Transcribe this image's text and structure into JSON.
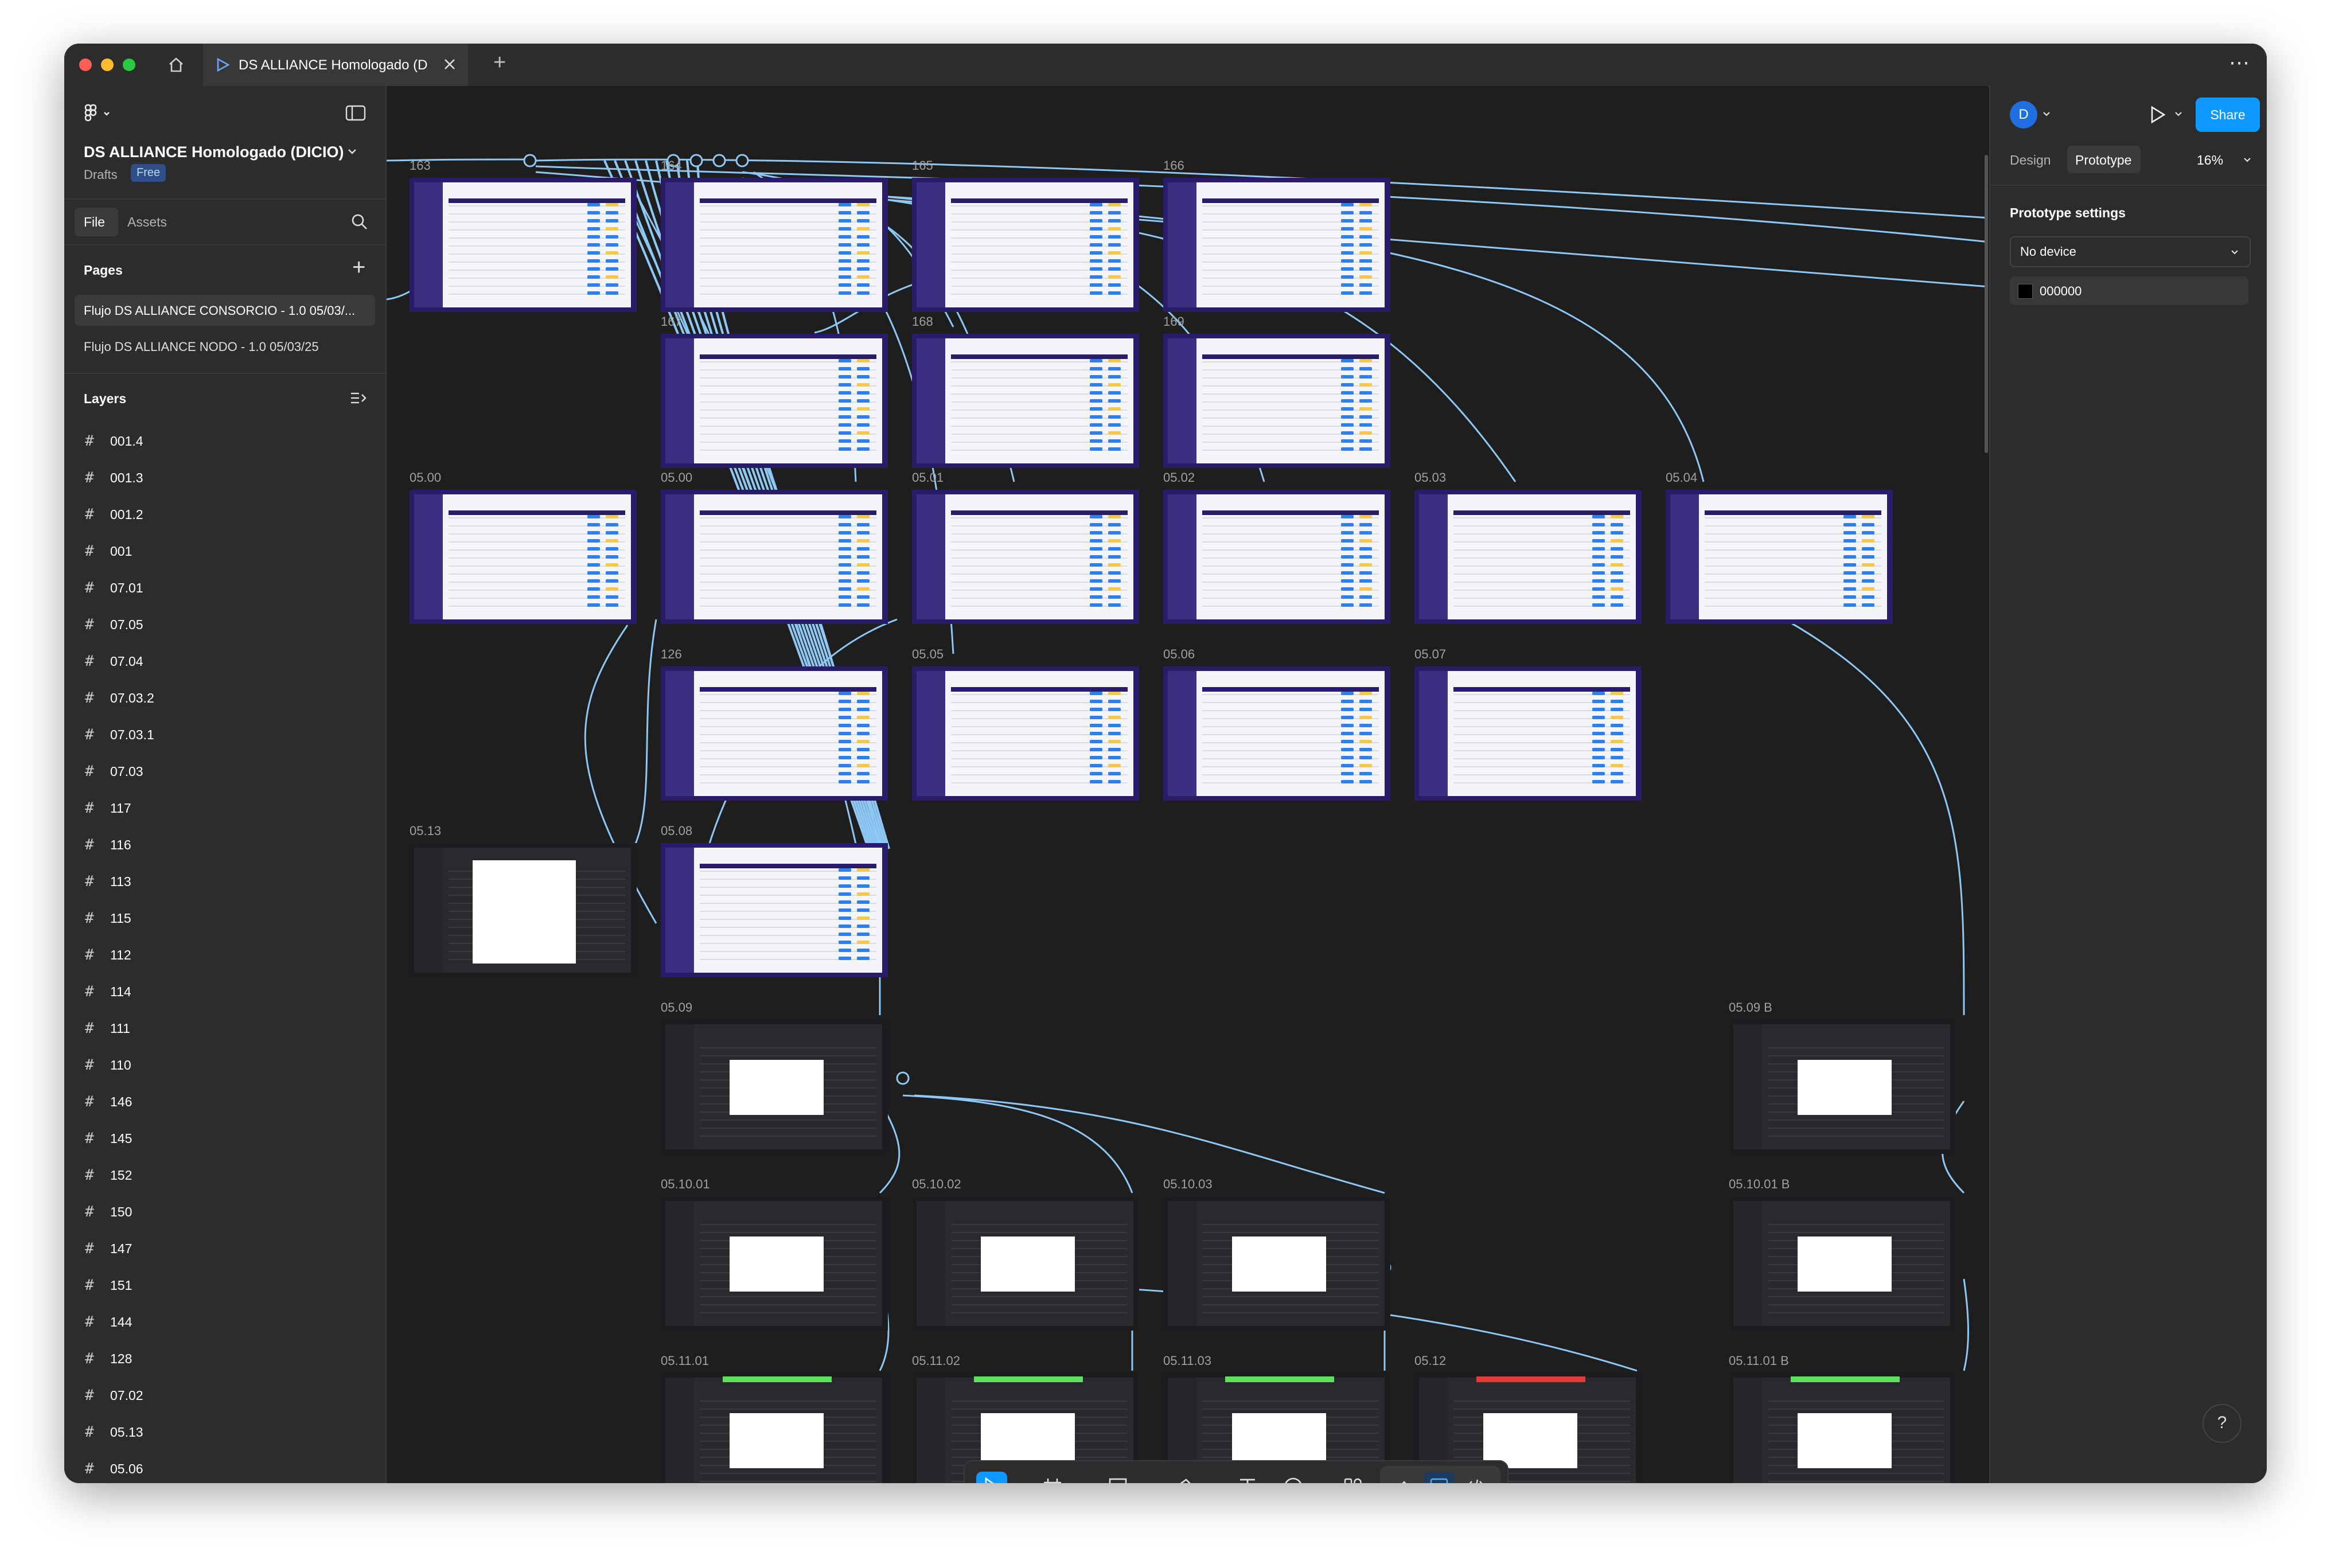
{
  "window": {
    "tab_title": "DS ALLIANCE Homologado (DICIO)",
    "new_tab": "+",
    "more": "⋯"
  },
  "left": {
    "file_name": "DS ALLIANCE Homologado (DICIO)",
    "drafts": "Drafts",
    "plan_badge": "Free",
    "tabs": {
      "file": "File",
      "assets": "Assets"
    },
    "pages_title": "Pages",
    "add_page": "+",
    "pages": [
      "Flujo DS ALLIANCE CONSORCIO - 1.0 05/03/...",
      "Flujo DS ALLIANCE NODO - 1.0 05/03/25"
    ],
    "layers_title": "Layers",
    "layers": [
      "001.4",
      "001.3",
      "001.2",
      "001",
      "07.01",
      "07.05",
      "07.04",
      "07.03.2",
      "07.03.1",
      "07.03",
      "117",
      "116",
      "113",
      "115",
      "112",
      "114",
      "111",
      "110",
      "146",
      "145",
      "152",
      "150",
      "147",
      "151",
      "144",
      "128",
      "07.02",
      "05.13",
      "05.06"
    ]
  },
  "right": {
    "avatar": "D",
    "share": "Share",
    "tab_design": "Design",
    "tab_prototype": "Prototype",
    "zoom": "16%",
    "settings_title": "Prototype settings",
    "device": "No device",
    "bg_color_value": "000000",
    "bg_color": "#000000"
  },
  "canvas": {
    "frames": [
      {
        "label": "163"
      },
      {
        "label": "164"
      },
      {
        "label": "165"
      },
      {
        "label": "166"
      },
      {
        "label": "167"
      },
      {
        "label": "168"
      },
      {
        "label": "169"
      },
      {
        "label": "05.00"
      },
      {
        "label": "05.00"
      },
      {
        "label": "05.01"
      },
      {
        "label": "05.02"
      },
      {
        "label": "05.03"
      },
      {
        "label": "05.04"
      },
      {
        "label": "126"
      },
      {
        "label": "05.05"
      },
      {
        "label": "05.06"
      },
      {
        "label": "05.07"
      },
      {
        "label": "05.13"
      },
      {
        "label": "05.08"
      },
      {
        "label": "05.09"
      },
      {
        "label": "05.09 B"
      },
      {
        "label": "05.10.01"
      },
      {
        "label": "05.10.02"
      },
      {
        "label": "05.10.03"
      },
      {
        "label": "05.10.01 B"
      },
      {
        "label": "05.11.01"
      },
      {
        "label": "05.11.02"
      },
      {
        "label": "05.11.03"
      },
      {
        "label": "05.12"
      },
      {
        "label": "05.11.01 B"
      }
    ],
    "connector_color": "#8ec8f5"
  },
  "help": "?"
}
